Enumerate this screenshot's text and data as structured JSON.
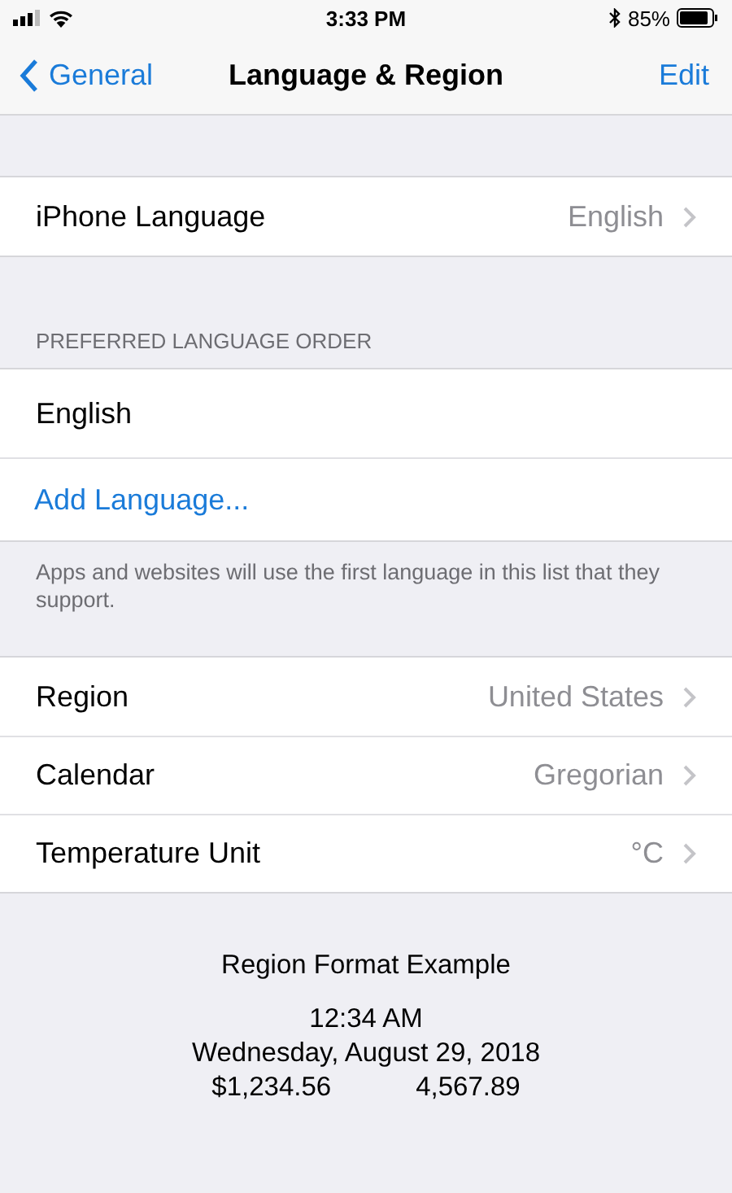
{
  "status_bar": {
    "time": "3:33 PM",
    "battery": "85%"
  },
  "nav": {
    "back": "General",
    "title": "Language & Region",
    "action": "Edit"
  },
  "iphone_language": {
    "label": "iPhone Language",
    "value": "English"
  },
  "preferred_languages": {
    "header": "PREFERRED LANGUAGE ORDER",
    "items": [
      "English"
    ],
    "add": "Add Language...",
    "footer": "Apps and websites will use the first language in this list that they support."
  },
  "region_settings": [
    {
      "label": "Region",
      "value": "United States"
    },
    {
      "label": "Calendar",
      "value": "Gregorian"
    },
    {
      "label": "Temperature Unit",
      "value": "°C"
    }
  ],
  "format_example": {
    "title": "Region Format Example",
    "time": "12:34 AM",
    "date": "Wednesday, August 29, 2018",
    "currency": "$1,234.56",
    "number": "4,567.89"
  }
}
